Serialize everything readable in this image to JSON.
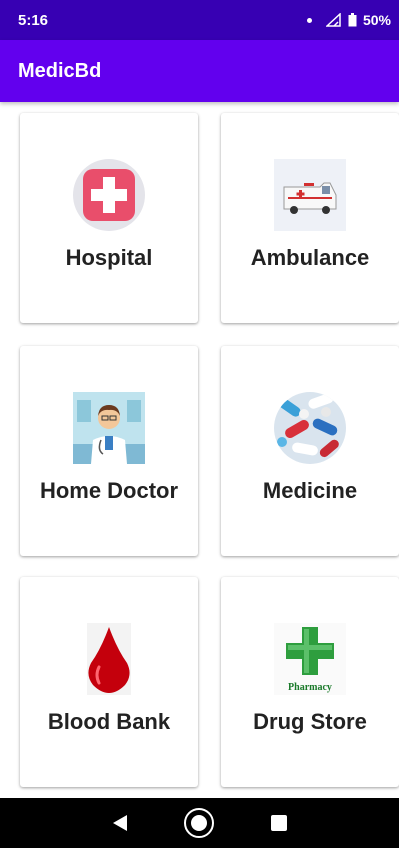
{
  "status_bar": {
    "time": "5:16",
    "battery": "50%",
    "icons": [
      "notification-dot-icon",
      "signal-icon",
      "battery-icon"
    ]
  },
  "app_bar": {
    "title": "MedicBd"
  },
  "cards": [
    {
      "label": "Hospital",
      "icon": "hospital-cross-icon"
    },
    {
      "label": "Ambulance",
      "icon": "ambulance-icon"
    },
    {
      "label": "Home Doctor",
      "icon": "doctor-icon"
    },
    {
      "label": "Medicine",
      "icon": "pills-icon"
    },
    {
      "label": "Blood Bank",
      "icon": "blood-drop-icon"
    },
    {
      "label": "Drug Store",
      "icon": "pharmacy-cross-icon",
      "icon_text": "Pharmacy"
    }
  ],
  "nav_bar": {
    "buttons": [
      "back-icon",
      "home-icon",
      "recents-icon"
    ]
  },
  "colors": {
    "status_bar": "#3700b3",
    "app_bar": "#6200ee",
    "hospital_red": "#e94e6b",
    "pharmacy_green": "#2e9e3e",
    "blood_red": "#c4000c"
  }
}
